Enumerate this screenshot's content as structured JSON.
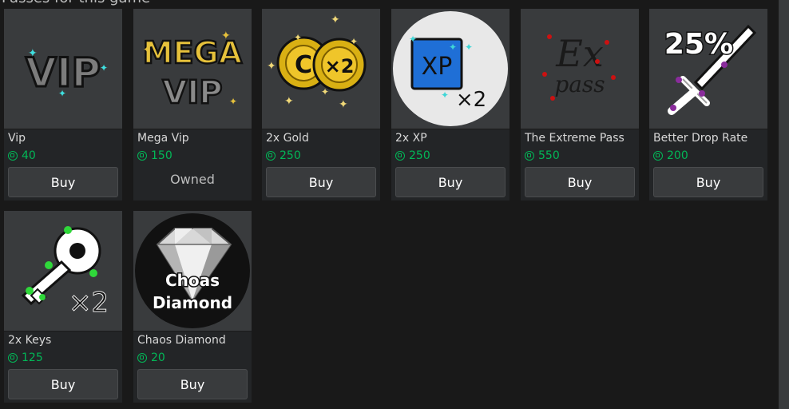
{
  "section_title": "Passes for this game",
  "colors": {
    "price_green": "#02b757",
    "card_bg": "#232527",
    "button_bg": "#393b3d"
  },
  "passes": [
    {
      "name": "Vip",
      "price": "40",
      "action": "Buy",
      "icon": "vip-icon",
      "image_text": "VIP"
    },
    {
      "name": "Mega Vip",
      "price": "150",
      "action": "Owned",
      "icon": "mega-vip-icon",
      "image_text": "MEGA VIP"
    },
    {
      "name": "2x Gold",
      "price": "250",
      "action": "Buy",
      "icon": "gold-coins-icon",
      "image_text": "C ×2"
    },
    {
      "name": "2x XP",
      "price": "250",
      "action": "Buy",
      "icon": "xp-icon",
      "image_text": "XP ×2"
    },
    {
      "name": "The Extreme Pass",
      "price": "550",
      "action": "Buy",
      "icon": "extreme-pass-icon",
      "image_text": "Ex pass"
    },
    {
      "name": "Better Drop Rate",
      "price": "200",
      "action": "Buy",
      "icon": "sword-icon",
      "image_text": "25%"
    },
    {
      "name": "2x Keys",
      "price": "125",
      "action": "Buy",
      "icon": "key-icon",
      "image_text": "×2"
    },
    {
      "name": "Chaos Diamond",
      "price": "20",
      "action": "Buy",
      "icon": "diamond-icon",
      "image_text": "Choas Diamond"
    }
  ]
}
